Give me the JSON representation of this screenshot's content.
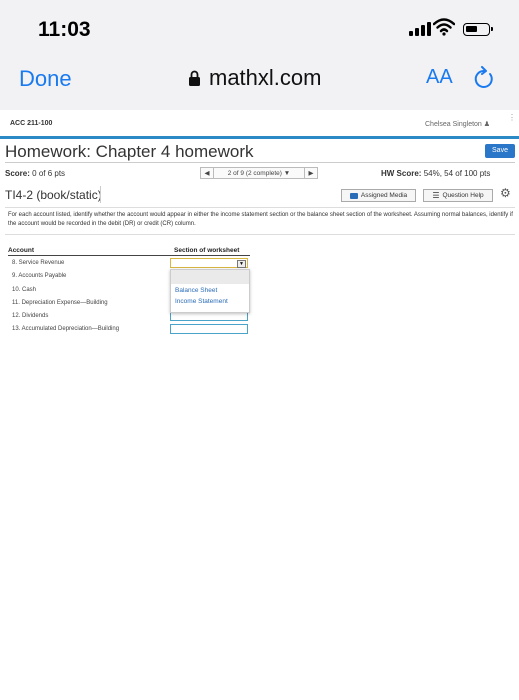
{
  "status": {
    "time": "11:03"
  },
  "browser": {
    "done_label": "Done",
    "url": "mathxl.com",
    "aa_label": "AA"
  },
  "course": {
    "code": "ACC 211-100",
    "user": "Chelsea Singleton"
  },
  "homework": {
    "title": "Homework: Chapter 4 homework",
    "save_label": "Save",
    "score_label": "Score:",
    "score_value": "0 of 6 pts",
    "nav_text": "2 of 9 (2 complete)",
    "hw_score_label": "HW Score:",
    "hw_score_value": "54%, 54 of 100 pts",
    "question_id": "TI4-2 (book/static)",
    "assigned_media": "Assigned Media",
    "question_help": "Question Help"
  },
  "instructions": "For each account listed, identify whether the account would appear in either the income statement section or the balance sheet section of the worksheet. Assuming normal balances, identify if the account would be recorded in the debit (DR) or credit (CR) column.",
  "table": {
    "col_account": "Account",
    "col_section": "Section of worksheet",
    "rows": [
      "8. Service Revenue",
      "9. Accounts Payable",
      "10. Cash",
      "11. Depreciation Expense—Building",
      "12. Dividends",
      "13. Accumulated Depreciation—Building"
    ]
  },
  "dropdown": {
    "options": [
      "Balance Sheet",
      "Income Statement"
    ]
  },
  "colors": {
    "accent": "#2b8ac6",
    "ios_blue": "#1a7af0",
    "save_button": "#2a76c8"
  }
}
